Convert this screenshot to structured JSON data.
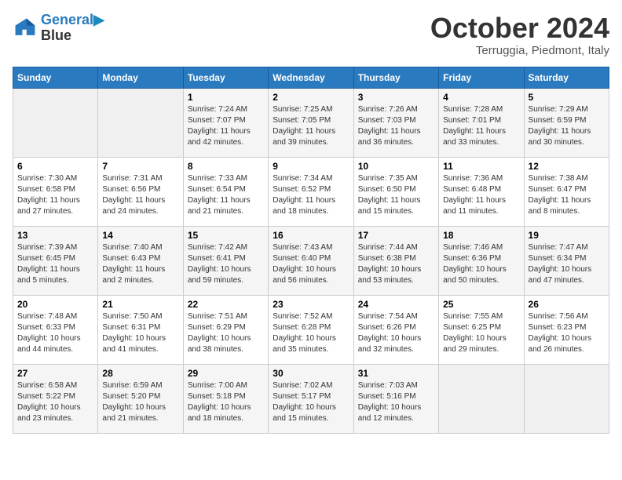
{
  "header": {
    "logo_line1": "General",
    "logo_line2": "Blue",
    "month_title": "October 2024",
    "subtitle": "Terruggia, Piedmont, Italy"
  },
  "days_of_week": [
    "Sunday",
    "Monday",
    "Tuesday",
    "Wednesday",
    "Thursday",
    "Friday",
    "Saturday"
  ],
  "weeks": [
    [
      {
        "num": "",
        "info": ""
      },
      {
        "num": "",
        "info": ""
      },
      {
        "num": "1",
        "info": "Sunrise: 7:24 AM\nSunset: 7:07 PM\nDaylight: 11 hours and 42 minutes."
      },
      {
        "num": "2",
        "info": "Sunrise: 7:25 AM\nSunset: 7:05 PM\nDaylight: 11 hours and 39 minutes."
      },
      {
        "num": "3",
        "info": "Sunrise: 7:26 AM\nSunset: 7:03 PM\nDaylight: 11 hours and 36 minutes."
      },
      {
        "num": "4",
        "info": "Sunrise: 7:28 AM\nSunset: 7:01 PM\nDaylight: 11 hours and 33 minutes."
      },
      {
        "num": "5",
        "info": "Sunrise: 7:29 AM\nSunset: 6:59 PM\nDaylight: 11 hours and 30 minutes."
      }
    ],
    [
      {
        "num": "6",
        "info": "Sunrise: 7:30 AM\nSunset: 6:58 PM\nDaylight: 11 hours and 27 minutes."
      },
      {
        "num": "7",
        "info": "Sunrise: 7:31 AM\nSunset: 6:56 PM\nDaylight: 11 hours and 24 minutes."
      },
      {
        "num": "8",
        "info": "Sunrise: 7:33 AM\nSunset: 6:54 PM\nDaylight: 11 hours and 21 minutes."
      },
      {
        "num": "9",
        "info": "Sunrise: 7:34 AM\nSunset: 6:52 PM\nDaylight: 11 hours and 18 minutes."
      },
      {
        "num": "10",
        "info": "Sunrise: 7:35 AM\nSunset: 6:50 PM\nDaylight: 11 hours and 15 minutes."
      },
      {
        "num": "11",
        "info": "Sunrise: 7:36 AM\nSunset: 6:48 PM\nDaylight: 11 hours and 11 minutes."
      },
      {
        "num": "12",
        "info": "Sunrise: 7:38 AM\nSunset: 6:47 PM\nDaylight: 11 hours and 8 minutes."
      }
    ],
    [
      {
        "num": "13",
        "info": "Sunrise: 7:39 AM\nSunset: 6:45 PM\nDaylight: 11 hours and 5 minutes."
      },
      {
        "num": "14",
        "info": "Sunrise: 7:40 AM\nSunset: 6:43 PM\nDaylight: 11 hours and 2 minutes."
      },
      {
        "num": "15",
        "info": "Sunrise: 7:42 AM\nSunset: 6:41 PM\nDaylight: 10 hours and 59 minutes."
      },
      {
        "num": "16",
        "info": "Sunrise: 7:43 AM\nSunset: 6:40 PM\nDaylight: 10 hours and 56 minutes."
      },
      {
        "num": "17",
        "info": "Sunrise: 7:44 AM\nSunset: 6:38 PM\nDaylight: 10 hours and 53 minutes."
      },
      {
        "num": "18",
        "info": "Sunrise: 7:46 AM\nSunset: 6:36 PM\nDaylight: 10 hours and 50 minutes."
      },
      {
        "num": "19",
        "info": "Sunrise: 7:47 AM\nSunset: 6:34 PM\nDaylight: 10 hours and 47 minutes."
      }
    ],
    [
      {
        "num": "20",
        "info": "Sunrise: 7:48 AM\nSunset: 6:33 PM\nDaylight: 10 hours and 44 minutes."
      },
      {
        "num": "21",
        "info": "Sunrise: 7:50 AM\nSunset: 6:31 PM\nDaylight: 10 hours and 41 minutes."
      },
      {
        "num": "22",
        "info": "Sunrise: 7:51 AM\nSunset: 6:29 PM\nDaylight: 10 hours and 38 minutes."
      },
      {
        "num": "23",
        "info": "Sunrise: 7:52 AM\nSunset: 6:28 PM\nDaylight: 10 hours and 35 minutes."
      },
      {
        "num": "24",
        "info": "Sunrise: 7:54 AM\nSunset: 6:26 PM\nDaylight: 10 hours and 32 minutes."
      },
      {
        "num": "25",
        "info": "Sunrise: 7:55 AM\nSunset: 6:25 PM\nDaylight: 10 hours and 29 minutes."
      },
      {
        "num": "26",
        "info": "Sunrise: 7:56 AM\nSunset: 6:23 PM\nDaylight: 10 hours and 26 minutes."
      }
    ],
    [
      {
        "num": "27",
        "info": "Sunrise: 6:58 AM\nSunset: 5:22 PM\nDaylight: 10 hours and 23 minutes."
      },
      {
        "num": "28",
        "info": "Sunrise: 6:59 AM\nSunset: 5:20 PM\nDaylight: 10 hours and 21 minutes."
      },
      {
        "num": "29",
        "info": "Sunrise: 7:00 AM\nSunset: 5:18 PM\nDaylight: 10 hours and 18 minutes."
      },
      {
        "num": "30",
        "info": "Sunrise: 7:02 AM\nSunset: 5:17 PM\nDaylight: 10 hours and 15 minutes."
      },
      {
        "num": "31",
        "info": "Sunrise: 7:03 AM\nSunset: 5:16 PM\nDaylight: 10 hours and 12 minutes."
      },
      {
        "num": "",
        "info": ""
      },
      {
        "num": "",
        "info": ""
      }
    ]
  ]
}
